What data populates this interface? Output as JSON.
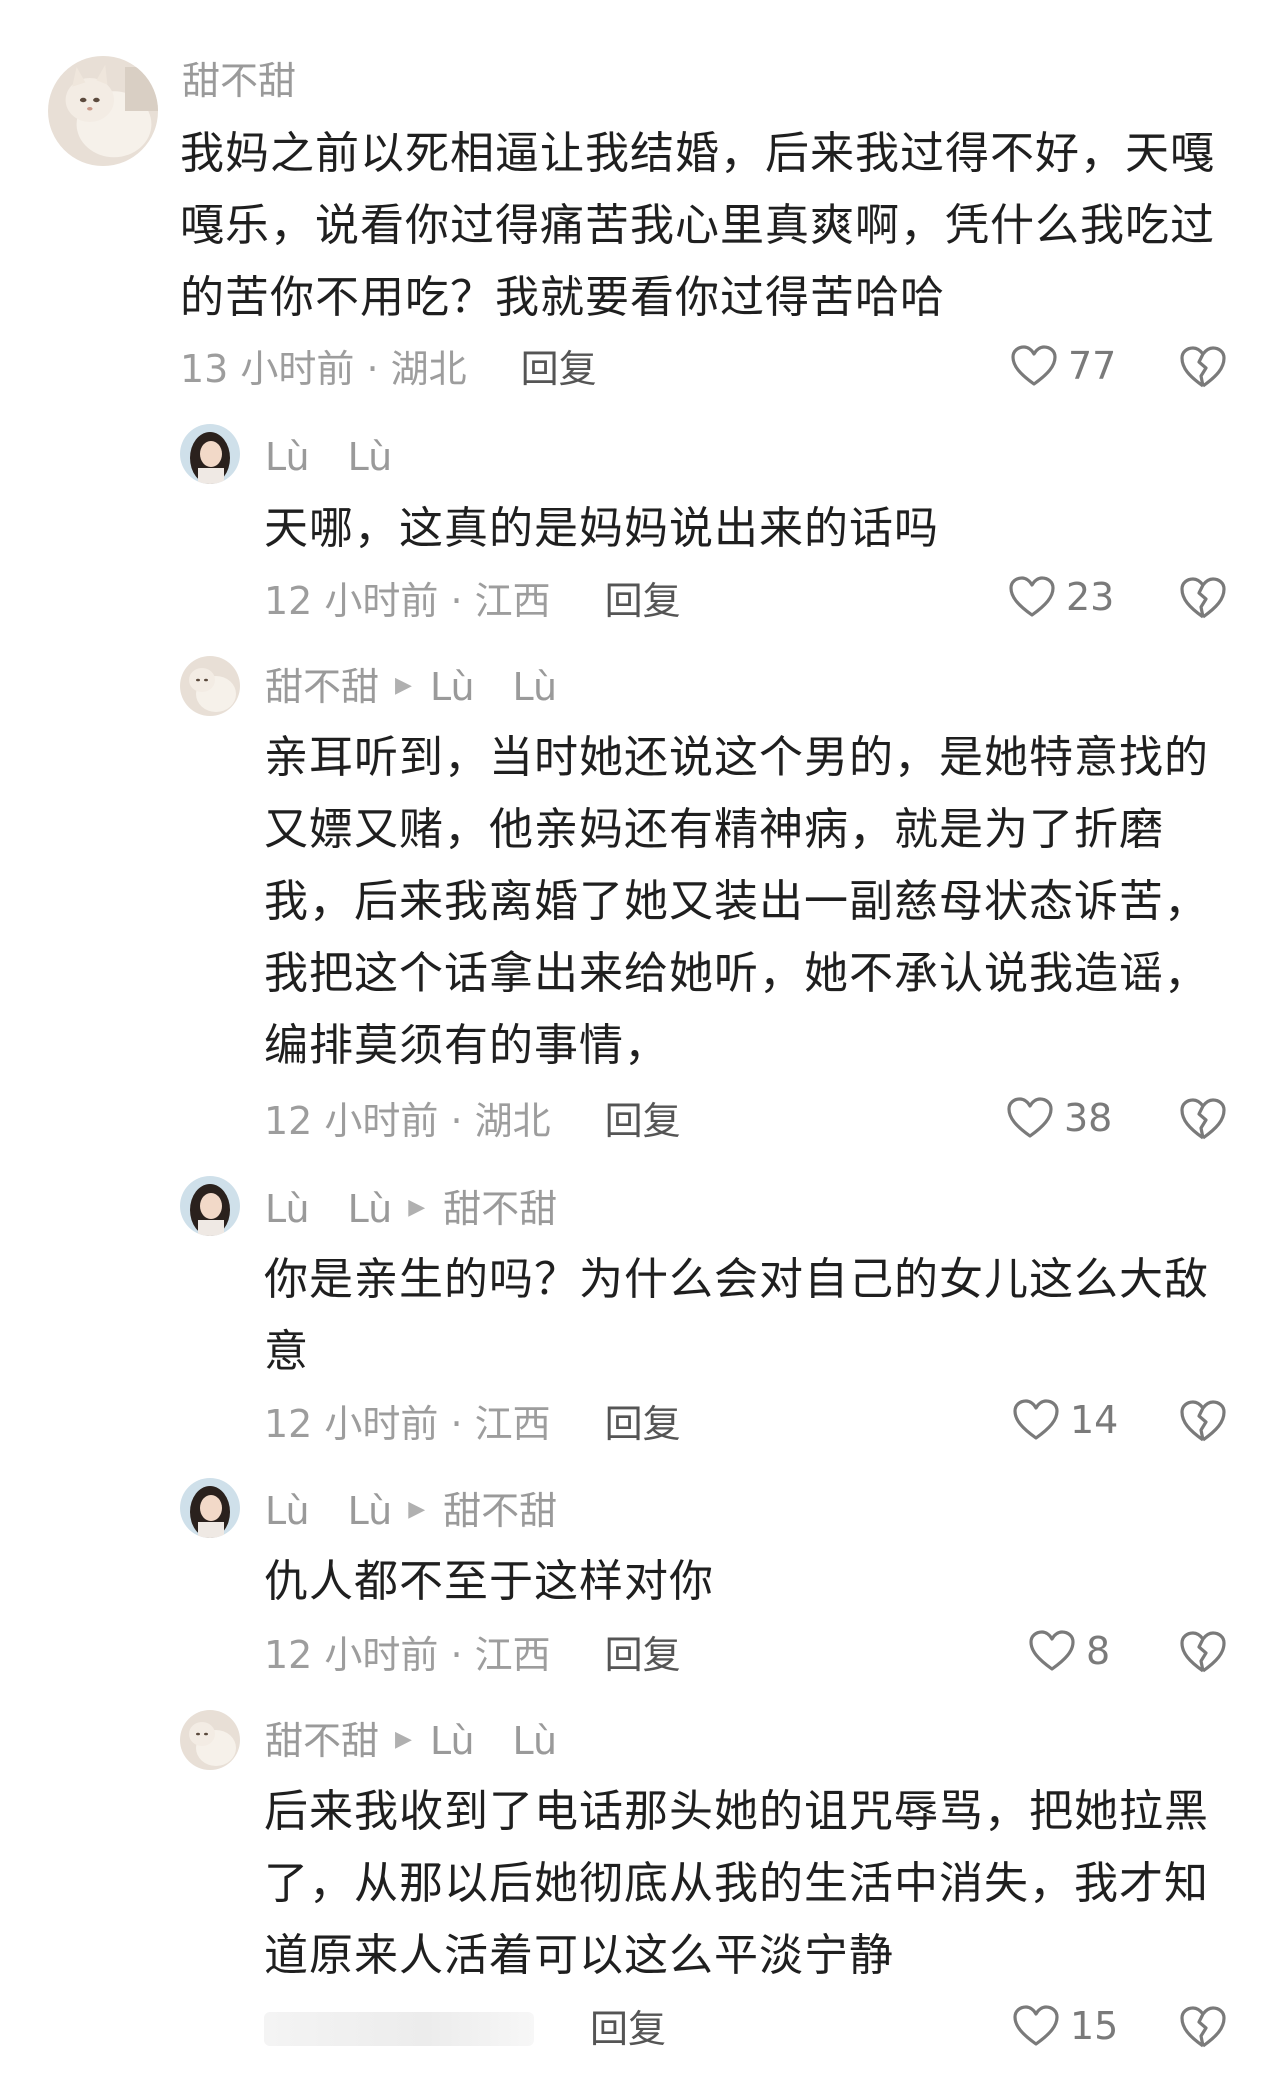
{
  "comments": [
    {
      "author": "甜不甜",
      "reply_to": "",
      "text": "我妈之前以死相逼让我结婚，后来我过得不好，天嘎嘎乐，说看你过得痛苦我心里真爽啊，凭什么我吃过的苦你不用吃？我就要看你过得苦哈哈",
      "meta": "13 小时前 · 湖北",
      "reply_label": "回复",
      "likes": "77",
      "avatar": "cat-avatar"
    },
    {
      "author": "Lù　Lù",
      "reply_to": "",
      "text": "天哪，这真的是妈妈说出来的话吗",
      "meta": "12 小时前 · 江西",
      "reply_label": "回复",
      "likes": "23",
      "avatar": "girl-avatar"
    },
    {
      "author": "甜不甜",
      "reply_to": "Lù　Lù",
      "text": "亲耳听到，当时她还说这个男的，是她特意找的又嫖又赌，他亲妈还有精神病，就是为了折磨我，后来我离婚了她又装出一副慈母状态诉苦，我把这个话拿出来给她听，她不承认说我造谣，编排莫须有的事情，",
      "meta": "12 小时前 · 湖北",
      "reply_label": "回复",
      "likes": "38",
      "avatar": "cat-avatar"
    },
    {
      "author": "Lù　Lù",
      "reply_to": "甜不甜",
      "text": "你是亲生的吗？为什么会对自己的女儿这么大敌意",
      "meta": "12 小时前 · 江西",
      "reply_label": "回复",
      "likes": "14",
      "avatar": "girl-avatar"
    },
    {
      "author": "Lù　Lù",
      "reply_to": "甜不甜",
      "text": "仇人都不至于这样对你",
      "meta": "12 小时前 · 江西",
      "reply_label": "回复",
      "likes": "8",
      "avatar": "girl-avatar"
    },
    {
      "author": "甜不甜",
      "reply_to": "Lù　Lù",
      "text": "后来我收到了电话那头她的诅咒辱骂，把她拉黑了，从那以后她彻底从我的生活中消失，我才知道原来人活着可以这么平淡宁静",
      "meta": "",
      "reply_label": "回复",
      "likes": "15",
      "avatar": "cat-avatar"
    }
  ],
  "icons": {
    "like": "heart-outline-icon",
    "dislike": "broken-heart-icon",
    "reply_arrow": "triangle-right-icon"
  },
  "colors": {
    "text": "#1f1f1f",
    "secondary": "#9d9d9d",
    "reply": "#555555"
  }
}
